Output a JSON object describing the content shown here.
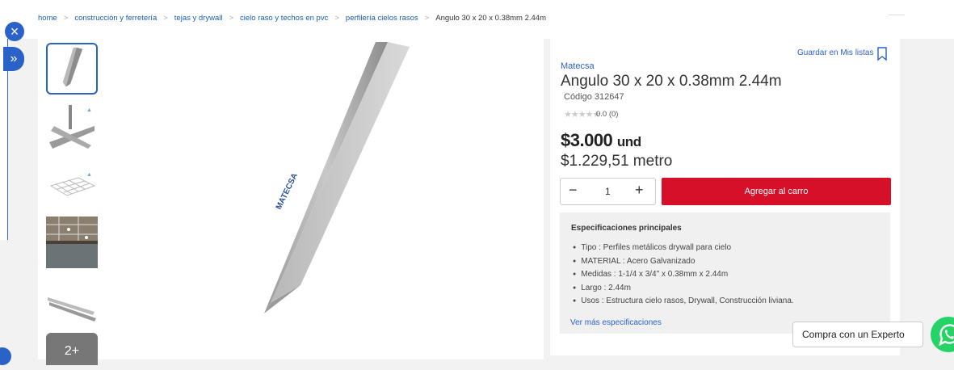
{
  "breadcrumb": {
    "items": [
      "home",
      "construcción y ferretería",
      "tejas y drywall",
      "cielo raso y techos en pvc",
      "perfilería cielos rasos"
    ],
    "current": "Angulo 30 x 20 x 0.38mm 2.44m",
    "separator": ">"
  },
  "sidebar": {
    "close_icon": "×",
    "expand_icon": "»"
  },
  "gallery": {
    "more_label": "2+"
  },
  "product": {
    "save_label": "Guardar en Mis listas",
    "brand": "Matecsa",
    "title": "Angulo 30 x 20 x 0.38mm 2.44m",
    "code": "Código 312647",
    "stars": "★★★★★",
    "rating": "0.0  (0)",
    "price": "$3.000",
    "price_unit": "und",
    "price_per_metro": "$1.229,51 metro"
  },
  "cart": {
    "minus": "−",
    "quantity": "1",
    "plus": "+",
    "add_label": "Agregar al carro"
  },
  "specs": {
    "title": "Especificaciones principales",
    "items": [
      "Tipo : Perfiles metálicos drywall para cielo",
      "MATERIAL : Acero Galvanizado",
      "Medidas : 1-1/4 x 3/4\" x 0.38mm x 2.44m",
      "Largo : 2.44m",
      "Usos : Estructura cielo rasos, Drywall, Construcción liviana."
    ],
    "more_label": "Ver más especificaciones"
  },
  "expert": {
    "label": "Compra con un Experto"
  },
  "image": {
    "brand_text": "MATECSA"
  },
  "colors": {
    "accent": "#2b62c8",
    "cta": "#d7102a",
    "whatsapp": "#25d366"
  }
}
